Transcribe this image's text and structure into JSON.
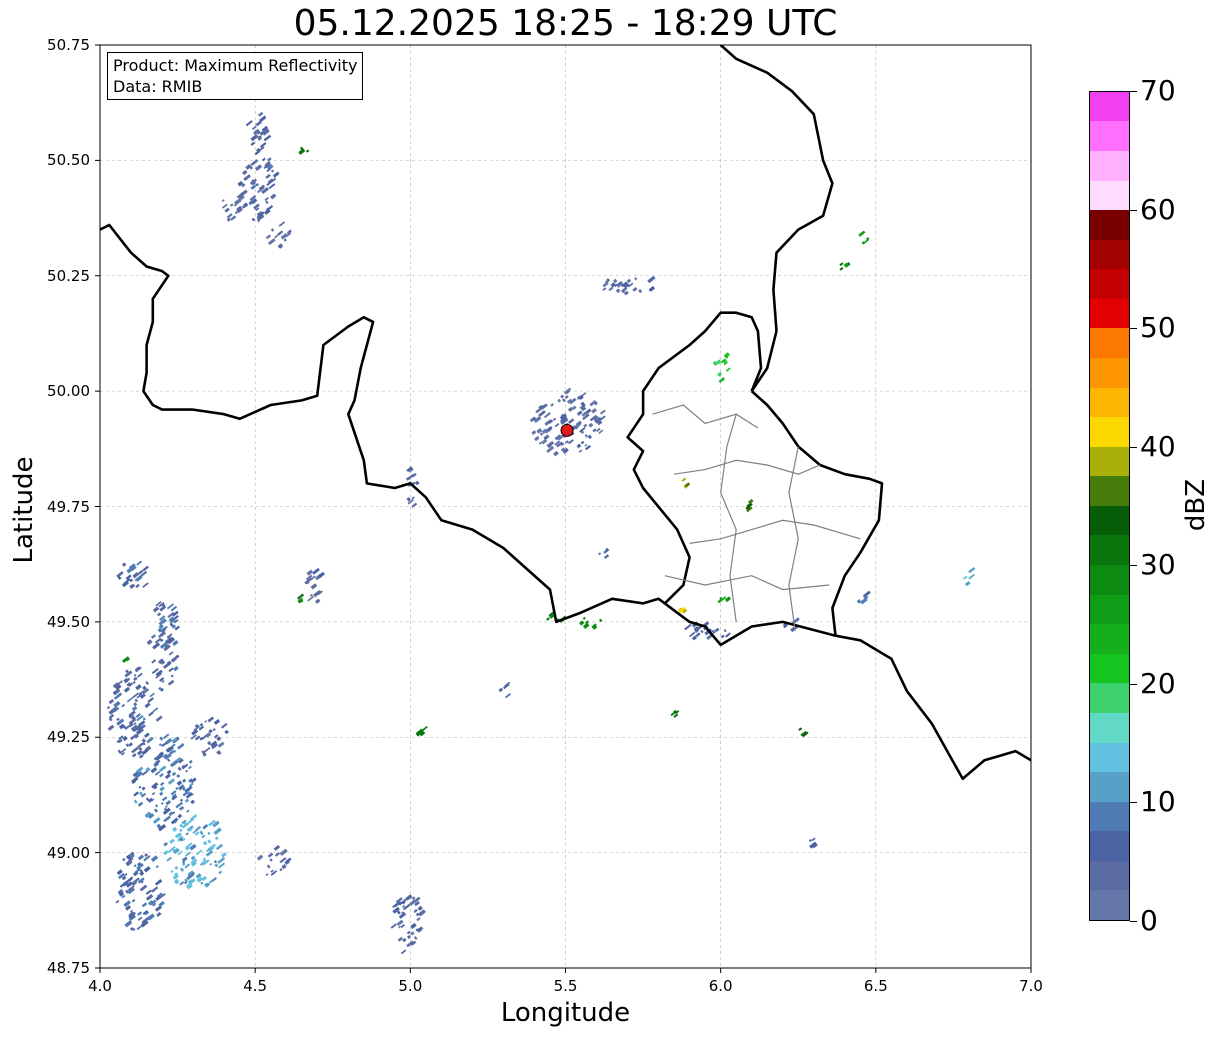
{
  "title": "05.12.2025 18:25 - 18:29 UTC",
  "info": {
    "product": "Product: Maximum Reflectivity",
    "data_source": "Data: RMIB"
  },
  "axes": {
    "xlabel": "Longitude",
    "ylabel": "Latitude",
    "xlim": [
      4.0,
      7.0
    ],
    "ylim": [
      48.75,
      50.75
    ],
    "xticks": [
      "4.0",
      "4.5",
      "5.0",
      "5.5",
      "6.0",
      "6.5",
      "7.0"
    ],
    "yticks": [
      "50.75",
      "50.50",
      "50.25",
      "50.00",
      "49.75",
      "49.50",
      "49.25",
      "49.00",
      "48.75"
    ],
    "grid": true
  },
  "radar_site": {
    "lon": 5.505,
    "lat": 49.915,
    "color": "#e31a1c"
  },
  "colorbar": {
    "label": "dBZ",
    "min": 0,
    "max": 70,
    "ticks": [
      "0",
      "10",
      "20",
      "30",
      "40",
      "50",
      "60",
      "70"
    ],
    "colors": [
      "#6477a8",
      "#5a6ba3",
      "#4b62a3",
      "#4f7cb4",
      "#57a0c8",
      "#62c0e0",
      "#62d8c6",
      "#3ed26e",
      "#16c420",
      "#13b01c",
      "#0f9c16",
      "#0c8a12",
      "#0a760e",
      "#075e09",
      "#467c0a",
      "#aab00a",
      "#fcd700",
      "#fcb500",
      "#fc9500",
      "#fc7800",
      "#e30000",
      "#c40000",
      "#a30000",
      "#7a0000",
      "#ffdcff",
      "#ffb0ff",
      "#ff70ff",
      "#f040f0"
    ]
  },
  "borders": {
    "country_color": "#000000",
    "region_color": "#808080",
    "france_belgium": [
      [
        4.0,
        50.35
      ],
      [
        4.03,
        50.36
      ],
      [
        4.1,
        50.3
      ],
      [
        4.15,
        50.27
      ],
      [
        4.2,
        50.26
      ],
      [
        4.22,
        50.25
      ],
      [
        4.17,
        50.2
      ],
      [
        4.17,
        50.15
      ],
      [
        4.15,
        50.1
      ],
      [
        4.15,
        50.04
      ],
      [
        4.14,
        50.0
      ],
      [
        4.17,
        49.97
      ],
      [
        4.2,
        49.96
      ],
      [
        4.3,
        49.96
      ],
      [
        4.4,
        49.95
      ],
      [
        4.45,
        49.94
      ],
      [
        4.55,
        49.97
      ],
      [
        4.65,
        49.98
      ],
      [
        4.7,
        49.99
      ],
      [
        4.72,
        50.1
      ],
      [
        4.8,
        50.14
      ],
      [
        4.85,
        50.16
      ],
      [
        4.88,
        50.15
      ],
      [
        4.86,
        50.1
      ],
      [
        4.84,
        50.05
      ],
      [
        4.82,
        49.98
      ],
      [
        4.8,
        49.95
      ],
      [
        4.85,
        49.85
      ],
      [
        4.86,
        49.8
      ],
      [
        4.95,
        49.79
      ],
      [
        5.0,
        49.8
      ],
      [
        5.05,
        49.77
      ],
      [
        5.1,
        49.72
      ],
      [
        5.2,
        49.7
      ],
      [
        5.3,
        49.66
      ],
      [
        5.35,
        49.63
      ],
      [
        5.45,
        49.57
      ],
      [
        5.47,
        49.5
      ],
      [
        5.55,
        49.52
      ],
      [
        5.65,
        49.55
      ],
      [
        5.75,
        49.54
      ],
      [
        5.8,
        49.55
      ],
      [
        5.82,
        49.54
      ]
    ],
    "belgium_lux": [
      [
        5.82,
        49.54
      ],
      [
        5.88,
        49.58
      ],
      [
        5.9,
        49.64
      ],
      [
        5.86,
        49.7
      ],
      [
        5.75,
        49.79
      ],
      [
        5.72,
        49.83
      ],
      [
        5.75,
        49.87
      ],
      [
        5.7,
        49.9
      ],
      [
        5.75,
        49.95
      ],
      [
        5.75,
        50.0
      ],
      [
        5.8,
        50.05
      ],
      [
        5.9,
        50.1
      ],
      [
        5.95,
        50.13
      ],
      [
        6.0,
        50.17
      ],
      [
        6.05,
        50.17
      ],
      [
        6.1,
        50.16
      ],
      [
        6.12,
        50.13
      ],
      [
        6.13,
        50.05
      ],
      [
        6.1,
        50.0
      ]
    ],
    "lux_germany": [
      [
        6.1,
        50.0
      ],
      [
        6.15,
        49.97
      ],
      [
        6.2,
        49.93
      ],
      [
        6.25,
        49.88
      ],
      [
        6.32,
        49.84
      ],
      [
        6.4,
        49.82
      ],
      [
        6.48,
        49.81
      ],
      [
        6.52,
        49.8
      ],
      [
        6.51,
        49.72
      ],
      [
        6.45,
        49.65
      ],
      [
        6.4,
        49.6
      ],
      [
        6.36,
        49.53
      ],
      [
        6.37,
        49.47
      ],
      [
        6.2,
        49.5
      ],
      [
        6.1,
        49.49
      ],
      [
        6.0,
        49.45
      ],
      [
        5.95,
        49.49
      ],
      [
        5.9,
        49.5
      ],
      [
        5.82,
        49.54
      ]
    ],
    "belgium_germany": [
      [
        6.1,
        50.0
      ],
      [
        6.15,
        50.05
      ],
      [
        6.18,
        50.13
      ],
      [
        6.17,
        50.22
      ],
      [
        6.18,
        50.3
      ],
      [
        6.25,
        50.35
      ],
      [
        6.33,
        50.38
      ],
      [
        6.36,
        50.45
      ],
      [
        6.33,
        50.5
      ],
      [
        6.3,
        50.6
      ],
      [
        6.23,
        50.65
      ],
      [
        6.15,
        50.69
      ],
      [
        6.05,
        50.72
      ],
      [
        6.0,
        50.75
      ]
    ],
    "france_germany": [
      [
        6.37,
        49.47
      ],
      [
        6.45,
        49.46
      ],
      [
        6.55,
        49.42
      ],
      [
        6.6,
        49.35
      ],
      [
        6.68,
        49.28
      ],
      [
        6.73,
        49.22
      ],
      [
        6.78,
        49.16
      ],
      [
        6.85,
        49.2
      ],
      [
        6.9,
        49.21
      ],
      [
        6.95,
        49.22
      ],
      [
        7.0,
        49.2
      ]
    ],
    "lux_cantons": [
      [
        [
          5.85,
          49.82
        ],
        [
          5.95,
          49.83
        ],
        [
          6.05,
          49.85
        ],
        [
          6.15,
          49.84
        ],
        [
          6.25,
          49.82
        ],
        [
          6.32,
          49.84
        ]
      ],
      [
        [
          5.9,
          49.67
        ],
        [
          6.0,
          49.68
        ],
        [
          6.1,
          49.7
        ],
        [
          6.2,
          49.72
        ],
        [
          6.3,
          49.71
        ],
        [
          6.45,
          49.68
        ]
      ],
      [
        [
          6.05,
          49.95
        ],
        [
          6.02,
          49.88
        ],
        [
          6.0,
          49.78
        ],
        [
          6.05,
          49.7
        ],
        [
          6.03,
          49.6
        ],
        [
          6.05,
          49.5
        ]
      ],
      [
        [
          6.25,
          49.88
        ],
        [
          6.22,
          49.78
        ],
        [
          6.25,
          49.68
        ],
        [
          6.22,
          49.58
        ],
        [
          6.24,
          49.48
        ]
      ],
      [
        [
          5.82,
          49.6
        ],
        [
          5.95,
          49.58
        ],
        [
          6.1,
          49.6
        ],
        [
          6.2,
          49.57
        ],
        [
          6.35,
          49.58
        ]
      ],
      [
        [
          5.78,
          49.95
        ],
        [
          5.88,
          49.97
        ],
        [
          5.95,
          49.93
        ],
        [
          6.05,
          49.95
        ],
        [
          6.12,
          49.92
        ]
      ]
    ]
  },
  "echoes": [
    {
      "lon": 4.5,
      "lat": 50.45,
      "rx": 0.06,
      "ry": 0.09,
      "dbz": 5
    },
    {
      "lon": 4.42,
      "lat": 50.4,
      "rx": 0.04,
      "ry": 0.03,
      "dbz": 3
    },
    {
      "lon": 4.57,
      "lat": 50.34,
      "rx": 0.04,
      "ry": 0.03,
      "dbz": 3
    },
    {
      "lon": 4.5,
      "lat": 50.56,
      "rx": 0.04,
      "ry": 0.04,
      "dbz": 4
    },
    {
      "lon": 4.1,
      "lat": 49.6,
      "rx": 0.06,
      "ry": 0.03,
      "dbz": 6
    },
    {
      "lon": 4.2,
      "lat": 49.45,
      "rx": 0.05,
      "ry": 0.1,
      "dbz": 6
    },
    {
      "lon": 4.1,
      "lat": 49.3,
      "rx": 0.08,
      "ry": 0.1,
      "dbz": 6
    },
    {
      "lon": 4.2,
      "lat": 49.15,
      "rx": 0.1,
      "ry": 0.1,
      "dbz": 8
    },
    {
      "lon": 4.3,
      "lat": 49.0,
      "rx": 0.1,
      "ry": 0.08,
      "dbz": 12
    },
    {
      "lon": 4.12,
      "lat": 48.92,
      "rx": 0.08,
      "ry": 0.09,
      "dbz": 6
    },
    {
      "lon": 4.35,
      "lat": 49.25,
      "rx": 0.06,
      "ry": 0.04,
      "dbz": 5
    },
    {
      "lon": 4.55,
      "lat": 48.98,
      "rx": 0.05,
      "ry": 0.03,
      "dbz": 4
    },
    {
      "lon": 4.98,
      "lat": 48.85,
      "rx": 0.05,
      "ry": 0.07,
      "dbz": 4
    },
    {
      "lon": 4.68,
      "lat": 49.58,
      "rx": 0.03,
      "ry": 0.04,
      "dbz": 4
    },
    {
      "lon": 5.0,
      "lat": 49.8,
      "rx": 0.02,
      "ry": 0.05,
      "dbz": 4
    },
    {
      "lon": 5.5,
      "lat": 49.93,
      "rx": 0.12,
      "ry": 0.07,
      "dbz": 3
    },
    {
      "lon": 5.7,
      "lat": 50.23,
      "rx": 0.1,
      "ry": 0.02,
      "dbz": 4
    },
    {
      "lon": 5.95,
      "lat": 49.48,
      "rx": 0.08,
      "ry": 0.02,
      "dbz": 6
    },
    {
      "lon": 5.45,
      "lat": 49.51,
      "rx": 0.04,
      "ry": 0.01,
      "dbz": 30
    },
    {
      "lon": 5.58,
      "lat": 49.5,
      "rx": 0.04,
      "ry": 0.015,
      "dbz": 28
    },
    {
      "lon": 6.0,
      "lat": 50.05,
      "rx": 0.03,
      "ry": 0.03,
      "dbz": 22
    },
    {
      "lon": 6.25,
      "lat": 49.26,
      "rx": 0.02,
      "ry": 0.01,
      "dbz": 30
    },
    {
      "lon": 4.65,
      "lat": 50.52,
      "rx": 0.015,
      "ry": 0.008,
      "dbz": 30
    },
    {
      "lon": 4.08,
      "lat": 49.42,
      "rx": 0.01,
      "ry": 0.01,
      "dbz": 30
    },
    {
      "lon": 5.03,
      "lat": 49.26,
      "rx": 0.015,
      "ry": 0.006,
      "dbz": 30
    },
    {
      "lon": 5.85,
      "lat": 49.3,
      "rx": 0.02,
      "ry": 0.008,
      "dbz": 30
    },
    {
      "lon": 6.08,
      "lat": 49.75,
      "rx": 0.01,
      "ry": 0.02,
      "dbz": 34
    },
    {
      "lon": 6.45,
      "lat": 50.33,
      "rx": 0.02,
      "ry": 0.01,
      "dbz": 28
    },
    {
      "lon": 6.38,
      "lat": 50.27,
      "rx": 0.02,
      "ry": 0.01,
      "dbz": 28
    },
    {
      "lon": 5.88,
      "lat": 49.8,
      "rx": 0.01,
      "ry": 0.01,
      "dbz": 38
    },
    {
      "lon": 6.29,
      "lat": 49.02,
      "rx": 0.02,
      "ry": 0.008,
      "dbz": 6
    },
    {
      "lon": 6.79,
      "lat": 49.6,
      "rx": 0.01,
      "ry": 0.02,
      "dbz": 14
    },
    {
      "lon": 6.45,
      "lat": 49.55,
      "rx": 0.015,
      "ry": 0.01,
      "dbz": 8
    },
    {
      "lon": 6.0,
      "lat": 49.55,
      "rx": 0.02,
      "ry": 0.01,
      "dbz": 26
    },
    {
      "lon": 5.87,
      "lat": 49.52,
      "rx": 0.015,
      "ry": 0.01,
      "dbz": 40
    },
    {
      "lon": 4.64,
      "lat": 49.55,
      "rx": 0.01,
      "ry": 0.01,
      "dbz": 30
    },
    {
      "lon": 5.62,
      "lat": 49.65,
      "rx": 0.02,
      "ry": 0.01,
      "dbz": 6
    },
    {
      "lon": 5.3,
      "lat": 49.35,
      "rx": 0.02,
      "ry": 0.015,
      "dbz": 6
    },
    {
      "lon": 6.22,
      "lat": 49.49,
      "rx": 0.02,
      "ry": 0.015,
      "dbz": 6
    }
  ]
}
